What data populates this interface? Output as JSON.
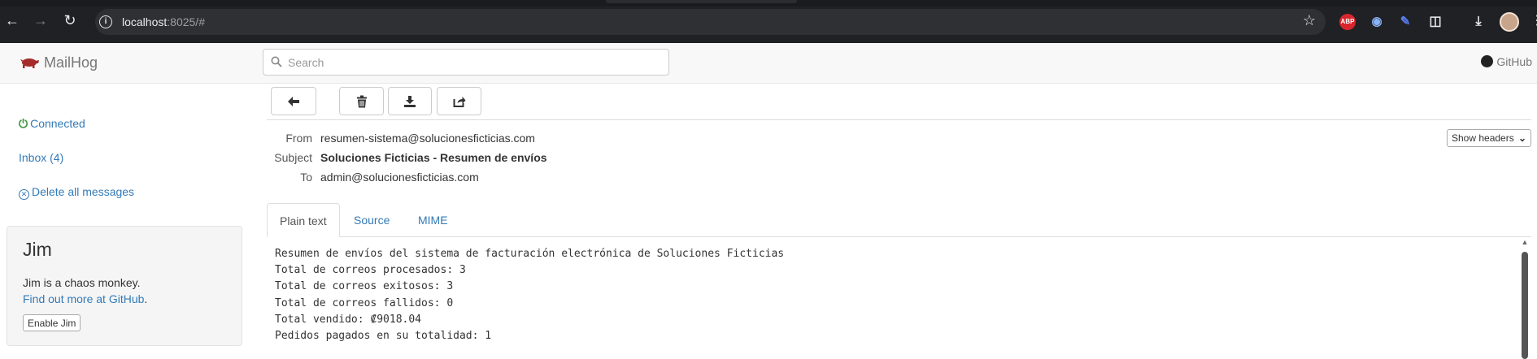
{
  "browser": {
    "url_host": "localhost",
    "url_rest": ":8025/#",
    "extensions": {
      "abp": "ABP"
    }
  },
  "navbar": {
    "brand": "MailHog",
    "search_placeholder": "Search",
    "github": "GitHub"
  },
  "sidebar": {
    "connected": "Connected",
    "inbox": "Inbox (4)",
    "delete_all": "Delete all messages",
    "jim": {
      "title": "Jim",
      "description": "Jim is a chaos monkey.",
      "more_link": "Find out more at GitHub",
      "more_suffix": ".",
      "enable_button": "Enable Jim"
    }
  },
  "message": {
    "headers": [
      {
        "label": "From",
        "value": "resumen-sistema@solucionesficticias.com"
      },
      {
        "label": "Subject",
        "value": "Soluciones Ficticias - Resumen de envíos"
      },
      {
        "label": "To",
        "value": "admin@solucionesficticias.com"
      }
    ],
    "show_headers": "Show headers",
    "tabs": [
      "Plain text",
      "Source",
      "MIME"
    ],
    "active_tab": "Plain text",
    "body_lines": [
      "Resumen de envíos del sistema de facturación electrónica de Soluciones Ficticias",
      "Total de correos procesados: 3",
      "Total de correos exitosos: 3",
      "Total de correos fallidos: 0",
      "Total vendido: ₡9018.04",
      "Pedidos pagados en su totalidad: 1"
    ]
  },
  "colors": {
    "link": "#337ab7",
    "connected_icon": "#3c963c",
    "pig": "#a52a2a",
    "chrome_bg": "#202124"
  }
}
